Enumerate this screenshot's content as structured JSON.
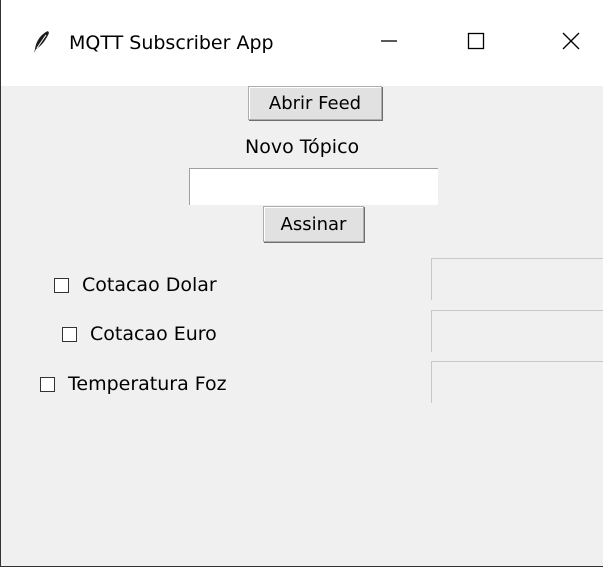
{
  "window": {
    "title": "MQTT Subscriber App",
    "icon": "feather-icon"
  },
  "title_controls": {
    "minimize_icon": "minimize-icon",
    "maximize_icon": "maximize-icon",
    "close_icon": "close-icon"
  },
  "main": {
    "open_feed_label": "Abrir Feed",
    "new_topic_label": "Novo Tópico",
    "new_topic_value": "",
    "subscribe_label": "Assinar",
    "topics": [
      {
        "label": "Cotacao Dolar",
        "checked": false,
        "value": ""
      },
      {
        "label": "Cotacao Euro",
        "checked": false,
        "value": ""
      },
      {
        "label": "Temperatura Foz",
        "checked": false,
        "value": ""
      }
    ]
  },
  "colors": {
    "window_bg": "#f0f0f0",
    "titlebar_bg": "#ffffff",
    "button_bg": "#e1e1e1"
  }
}
